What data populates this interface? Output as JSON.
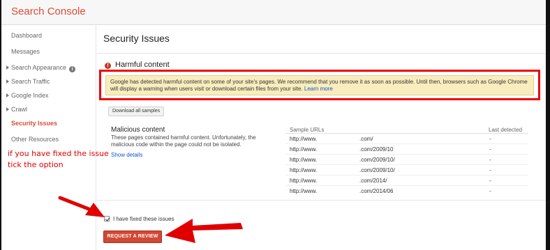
{
  "app": {
    "brand": "Search Console"
  },
  "sidebar": {
    "items": [
      {
        "label": "Dashboard",
        "expandable": false,
        "active": false
      },
      {
        "label": "Messages",
        "expandable": false,
        "active": false
      },
      {
        "label": "Search Appearance",
        "expandable": true,
        "active": false,
        "help_icon": "help-icon"
      },
      {
        "label": "Search Traffic",
        "expandable": true,
        "active": false
      },
      {
        "label": "Google Index",
        "expandable": true,
        "active": false
      },
      {
        "label": "Crawl",
        "expandable": true,
        "active": false
      },
      {
        "label": "Security Issues",
        "expandable": false,
        "active": true
      },
      {
        "label": "Other Resources",
        "expandable": false,
        "active": false
      }
    ]
  },
  "main": {
    "title": "Security Issues",
    "section_heading": "Harmful content",
    "section_icon": "warning-icon",
    "alert": {
      "text": "Google has detected harmful content on some of your site's pages. We recommend that you remove it as soon as possible. Until then, browsers such as Google Chrome will display a warning when users visit or download certain files from your site.",
      "link": "Learn more"
    },
    "download_button": "Download all samples",
    "issue": {
      "title": "Malicious content",
      "description": "These pages contained harmful content. Unfortunately, the malicious code within the page could not be isolated.",
      "show_details": "Show details"
    },
    "table": {
      "columns": [
        "Sample URLs",
        "Last detected"
      ],
      "rows": [
        {
          "prefix": "http://www.",
          "suffix": ".com/",
          "last_detected": "-"
        },
        {
          "prefix": "http://www.",
          "suffix": ".com/2009/10",
          "last_detected": "-"
        },
        {
          "prefix": "http://www.",
          "suffix": ".com/2009/10/",
          "last_detected": "-"
        },
        {
          "prefix": "http://www.",
          "suffix": ".com/2009/10/",
          "last_detected": "-"
        },
        {
          "prefix": "http://www.",
          "suffix": ".com/2014/",
          "last_detected": "-"
        },
        {
          "prefix": "http://www.",
          "suffix": ".com/2014/06",
          "last_detected": "-"
        }
      ]
    },
    "fixed_checkbox": {
      "label": "I have fixed these issues",
      "checked": true
    },
    "review_button": "REQUEST A REVIEW"
  },
  "annotation": {
    "line1": "if you have fixed the issue",
    "line2": "tick the option",
    "color": "#e00000"
  },
  "colors": {
    "brand": "#dd4b39",
    "alert_bg": "#f9edbe",
    "highlight_border": "#ee0000",
    "review_button": "#d14836",
    "link": "#1155cc"
  }
}
